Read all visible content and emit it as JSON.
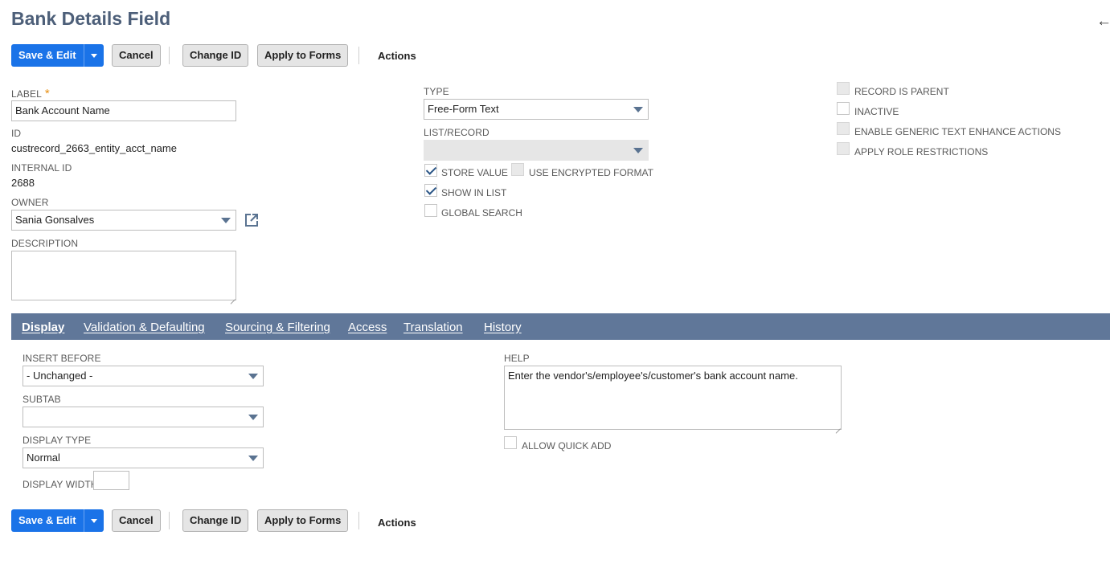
{
  "page": {
    "title": "Bank Details Field",
    "back_icon": "back-arrow-icon"
  },
  "toolbar": {
    "save_edit": "Save & Edit",
    "cancel": "Cancel",
    "change_id": "Change ID",
    "apply_to_forms": "Apply to Forms",
    "actions": "Actions"
  },
  "fields": {
    "label": {
      "label": "LABEL",
      "required_mark": "*",
      "value": "Bank Account Name"
    },
    "id": {
      "label": "ID",
      "value": "custrecord_2663_entity_acct_name"
    },
    "internal_id": {
      "label": "INTERNAL ID",
      "value": "2688"
    },
    "owner": {
      "label": "OWNER",
      "value": "Sania Gonsalves"
    },
    "description": {
      "label": "DESCRIPTION",
      "value": ""
    },
    "type": {
      "label": "TYPE",
      "value": "Free-Form Text"
    },
    "list_record": {
      "label": "LIST/RECORD",
      "value": ""
    }
  },
  "checkboxes": {
    "store_value": {
      "label": "STORE VALUE",
      "checked": true
    },
    "use_encrypted_format": {
      "label": "USE ENCRYPTED FORMAT",
      "checked": false
    },
    "show_in_list": {
      "label": "SHOW IN LIST",
      "checked": true
    },
    "global_search": {
      "label": "GLOBAL SEARCH",
      "checked": false
    },
    "record_is_parent": {
      "label": "RECORD IS PARENT",
      "checked": false
    },
    "inactive": {
      "label": "INACTIVE",
      "checked": false
    },
    "enable_generic_text": {
      "label": "ENABLE GENERIC TEXT ENHANCE ACTIONS",
      "checked": false
    },
    "apply_role_restrictions": {
      "label": "APPLY ROLE RESTRICTIONS",
      "checked": false
    },
    "allow_quick_add": {
      "label": "ALLOW QUICK ADD",
      "checked": false
    }
  },
  "tabs": [
    {
      "label": "Display",
      "active": true
    },
    {
      "label": "Validation & Defaulting",
      "active": false
    },
    {
      "label": "Sourcing & Filtering",
      "active": false
    },
    {
      "label": "Access",
      "active": false
    },
    {
      "label": "Translation",
      "active": false
    },
    {
      "label": "History",
      "active": false
    }
  ],
  "display_tab": {
    "insert_before": {
      "label": "INSERT BEFORE",
      "value": "- Unchanged -"
    },
    "subtab": {
      "label": "SUBTAB",
      "value": ""
    },
    "display_type": {
      "label": "DISPLAY TYPE",
      "value": "Normal"
    },
    "display_width": {
      "label": "DISPLAY WIDTH",
      "value": ""
    },
    "help": {
      "label": "HELP",
      "value": "Enter the vendor's/employee's/customer's bank account name."
    }
  },
  "colors": {
    "title": "#4d5f79",
    "primary_button": "#1a73e8",
    "tab_bar": "#607799",
    "required": "#e88f11"
  }
}
